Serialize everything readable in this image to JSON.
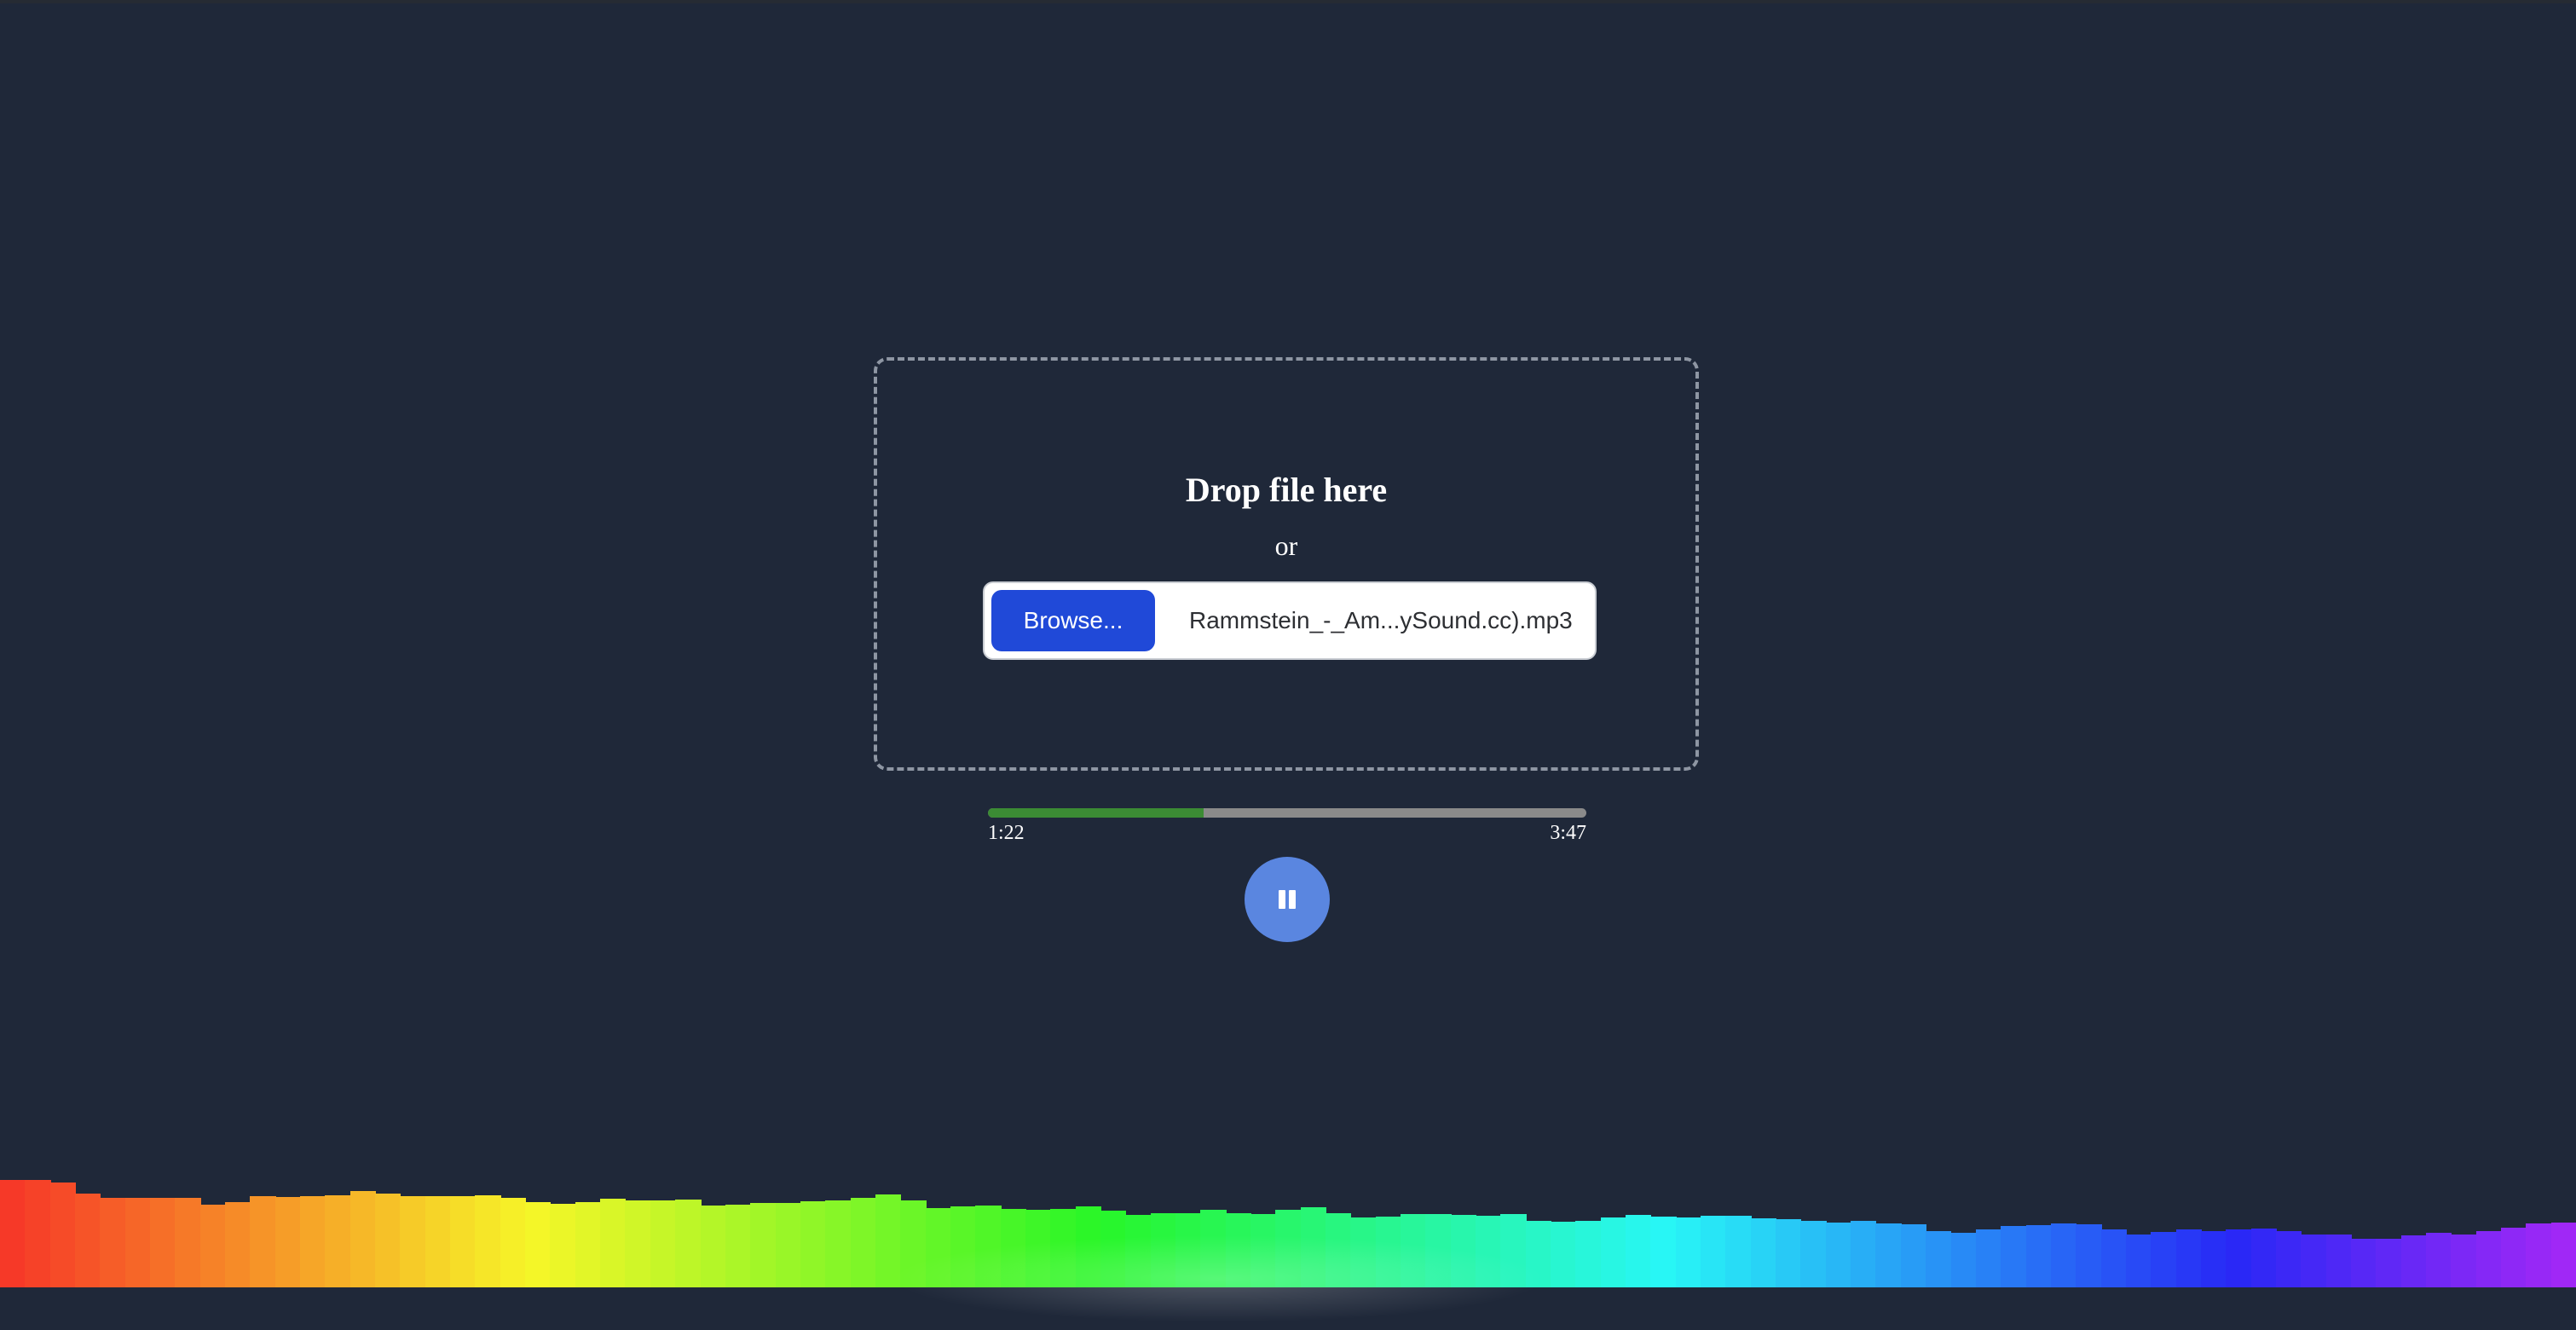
{
  "dropzone": {
    "title": "Drop file here",
    "or_text": "or",
    "browse_label": "Browse...",
    "file_name": "Rammstein_-_Am...ySound.cc).mp3"
  },
  "player": {
    "current_time": "1:22",
    "total_time": "3:47",
    "progress": 0.361,
    "state": "playing",
    "button_icon": "pause-icon"
  },
  "colors": {
    "background": "#1f2839",
    "browse_button": "#2049d8",
    "progress_fill": "#3b8b34",
    "progress_track": "#8a8a8a",
    "play_button": "#5a86e0"
  },
  "visualizer": {
    "levels": [
      0.494,
      0.494,
      0.482,
      0.431,
      0.412,
      0.412,
      0.412,
      0.412,
      0.38,
      0.392,
      0.42,
      0.416,
      0.42,
      0.424,
      0.443,
      0.431,
      0.42,
      0.42,
      0.42,
      0.424,
      0.412,
      0.392,
      0.384,
      0.392,
      0.408,
      0.4,
      0.4,
      0.404,
      0.376,
      0.38,
      0.388,
      0.388,
      0.396,
      0.4,
      0.412,
      0.427,
      0.4,
      0.365,
      0.373,
      0.376,
      0.361,
      0.357,
      0.361,
      0.373,
      0.353,
      0.333,
      0.341,
      0.341,
      0.357,
      0.341,
      0.337,
      0.357,
      0.369,
      0.341,
      0.322,
      0.325,
      0.337,
      0.337,
      0.333,
      0.329,
      0.337,
      0.306,
      0.302,
      0.306,
      0.322,
      0.333,
      0.325,
      0.322,
      0.329,
      0.329,
      0.318,
      0.314,
      0.306,
      0.298,
      0.306,
      0.294,
      0.29,
      0.259,
      0.251,
      0.267,
      0.282,
      0.286,
      0.294,
      0.29,
      0.267,
      0.243,
      0.255,
      0.267,
      0.259,
      0.267,
      0.271,
      0.259,
      0.243,
      0.243,
      0.224,
      0.224,
      0.239,
      0.251,
      0.243,
      0.259,
      0.275,
      0.294,
      0.298
    ]
  }
}
